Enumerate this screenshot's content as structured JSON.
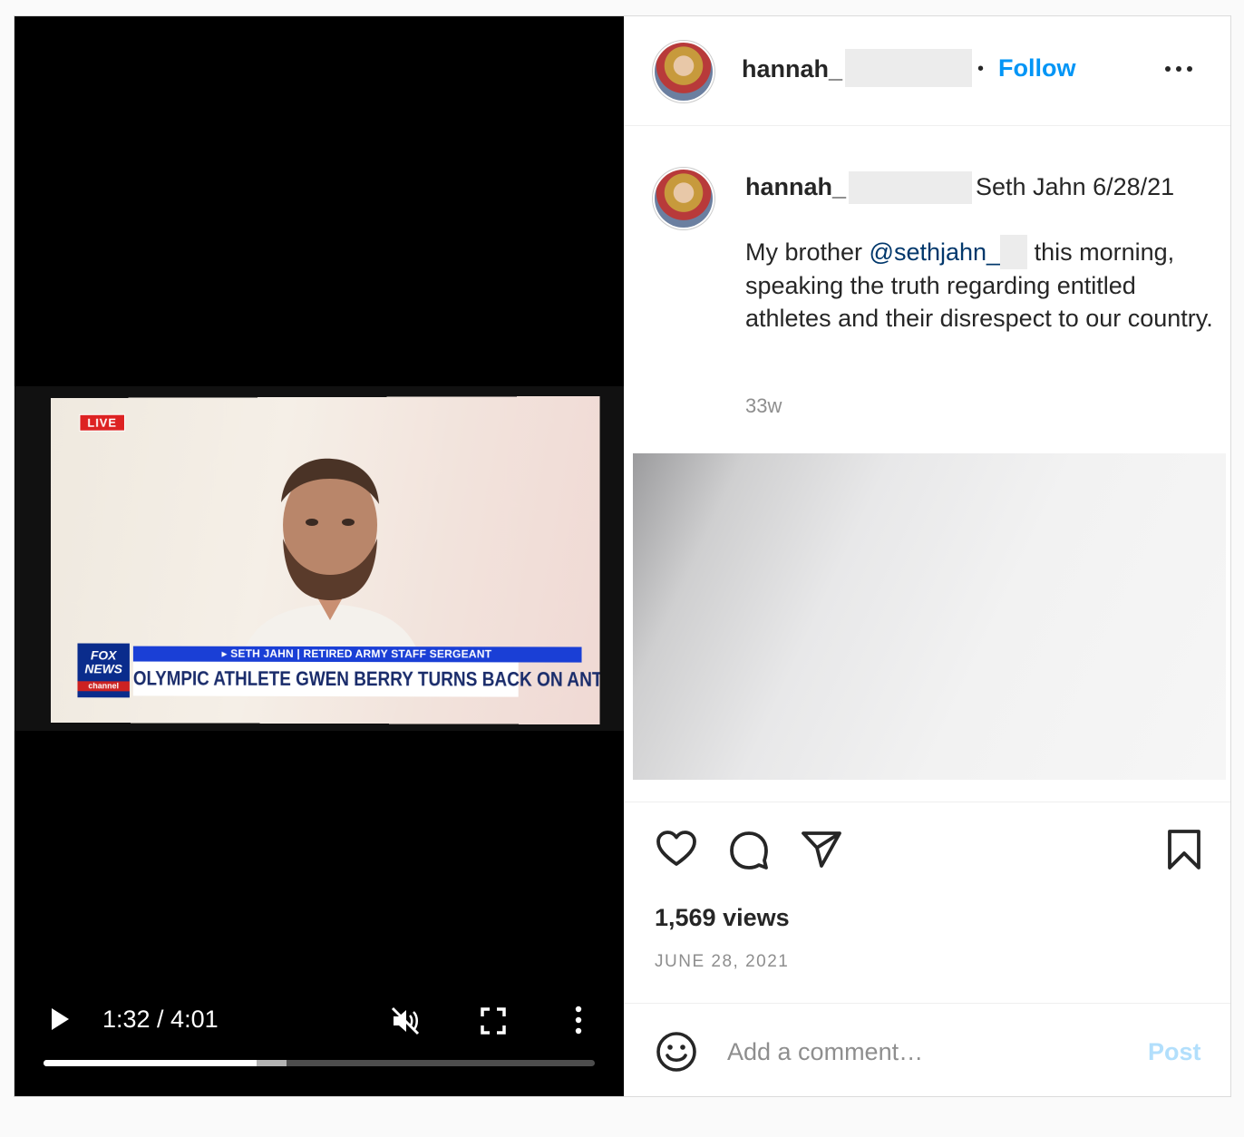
{
  "video": {
    "screen": {
      "live_badge": "LIVE",
      "network_logo_line1": "FOX",
      "network_logo_line2": "NEWS",
      "network_logo_line3": "channel",
      "name_bar": "▸ SETH JAHN | RETIRED ARMY STAFF SERGEANT",
      "headline": "OLYMPIC ATHLETE GWEN BERRY TURNS BACK ON ANTHEM"
    },
    "controls": {
      "time": "1:32 / 4:01",
      "played_fraction": 0.386,
      "buffered_fraction": 0.441,
      "icons": [
        "play-icon",
        "muted-speaker-icon",
        "fullscreen-icon",
        "more-vertical-icon"
      ]
    }
  },
  "header": {
    "username": "hannah_",
    "separator": "•",
    "follow_label": "Follow"
  },
  "caption": {
    "username": "hannah_",
    "title": "Seth Jahn 6/28/21",
    "text_before": "My brother ",
    "mention": "@sethjahn_",
    "text_after": " this morning, speaking the truth regarding entitled athletes and their disrespect to our country.",
    "age": "33w"
  },
  "actions": {
    "icons": [
      "heart-icon",
      "comment-icon",
      "share-icon",
      "bookmark-icon"
    ],
    "views": "1,569 views",
    "date": "JUNE 28, 2021"
  },
  "comment_box": {
    "placeholder": "Add a comment…",
    "post_label": "Post"
  },
  "colors": {
    "accent": "#0095f6",
    "mention": "#00376b",
    "post_disabled": "#b2dffc"
  }
}
